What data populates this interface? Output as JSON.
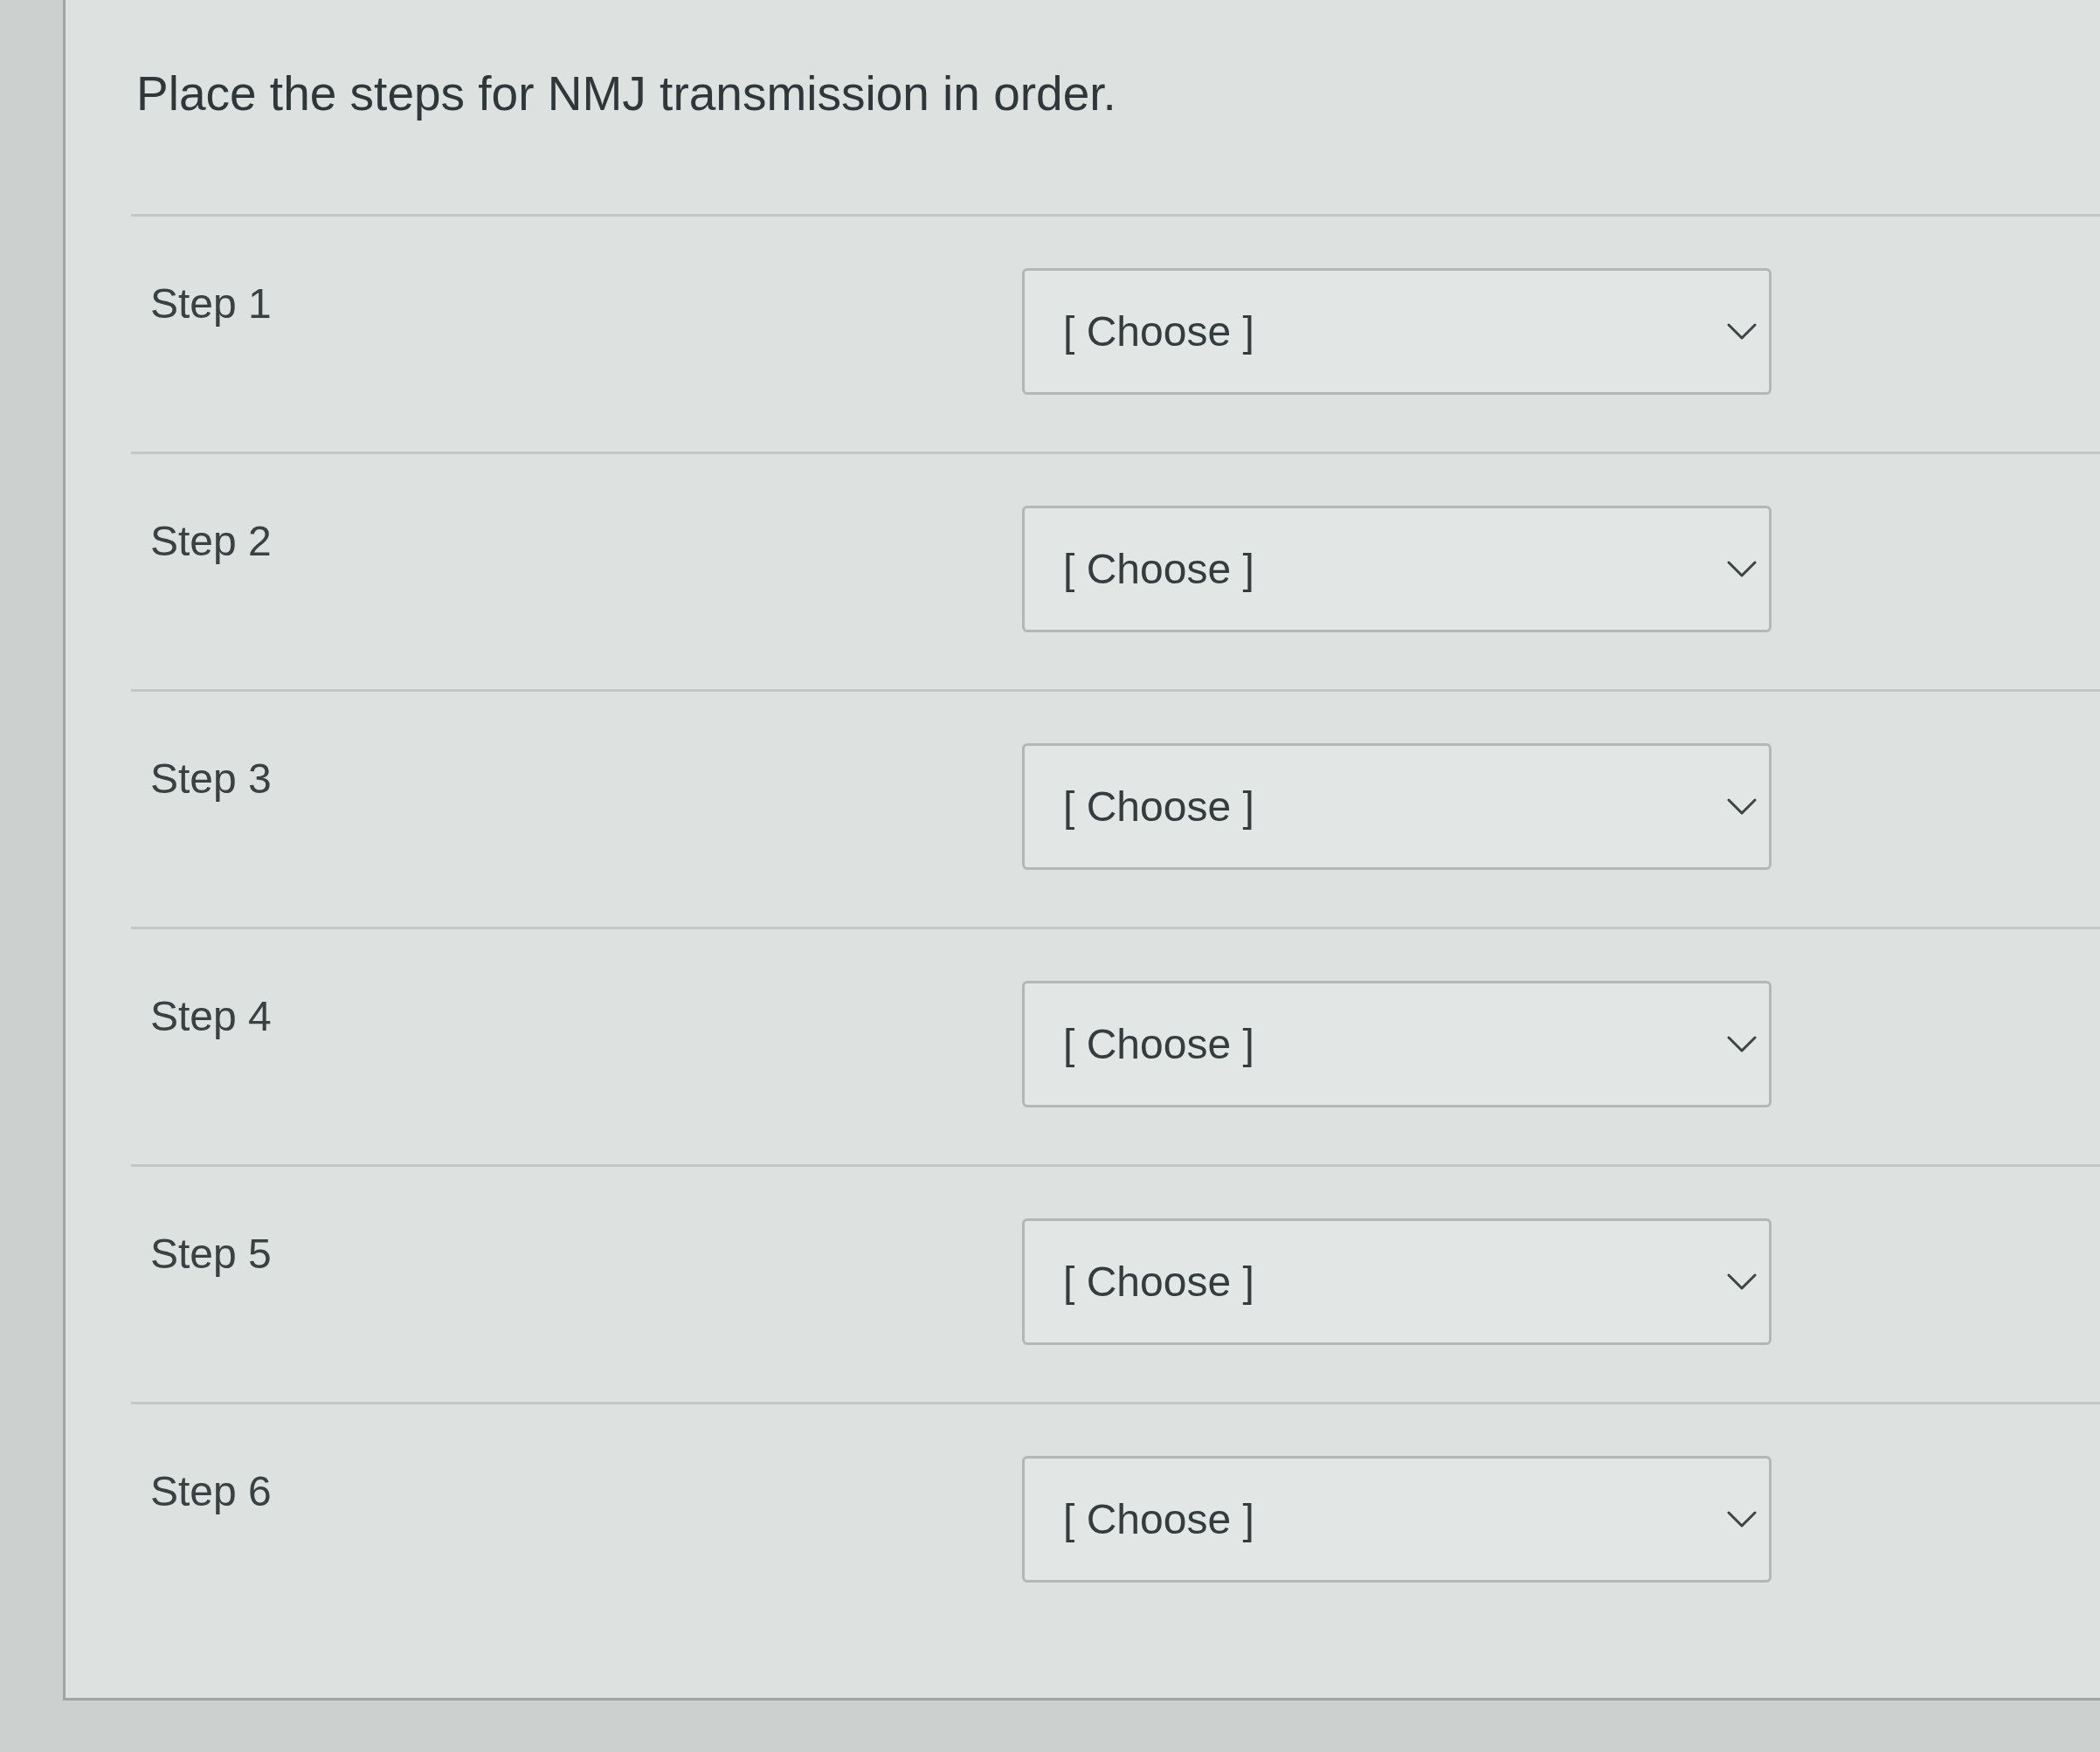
{
  "question": {
    "prompt": "Place the steps for NMJ transmission in order."
  },
  "rows": [
    {
      "label": "Step 1",
      "select": {
        "placeholder": "[ Choose ]"
      }
    },
    {
      "label": "Step 2",
      "select": {
        "placeholder": "[ Choose ]"
      }
    },
    {
      "label": "Step 3",
      "select": {
        "placeholder": "[ Choose ]"
      }
    },
    {
      "label": "Step 4",
      "select": {
        "placeholder": "[ Choose ]"
      }
    },
    {
      "label": "Step 5",
      "select": {
        "placeholder": "[ Choose ]"
      }
    },
    {
      "label": "Step 6",
      "select": {
        "placeholder": "[ Choose ]"
      }
    }
  ]
}
